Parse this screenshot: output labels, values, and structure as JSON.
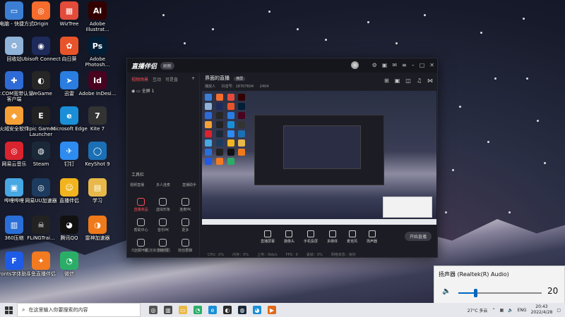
{
  "desktop": {
    "icons": [
      {
        "label": "此电脑 - 快捷方式",
        "color": "#3b7ed4",
        "glyph": "▭"
      },
      {
        "label": "Origin",
        "color": "#f56c2d",
        "glyph": "◎"
      },
      {
        "label": "WizTree",
        "color": "#e34b3a",
        "glyph": "▦"
      },
      {
        "label": "Adobe Illustrat...",
        "color": "#330000",
        "glyph": "Ai"
      },
      {
        "label": "回收站",
        "color": "#8fb3d9",
        "glyph": "♻"
      },
      {
        "label": "Ubisoft Connect",
        "color": "#1e2a5a",
        "glyph": "◉"
      },
      {
        "label": "向日葵",
        "color": "#e8542a",
        "glyph": "✿"
      },
      {
        "label": "Adobe Photosh...",
        "color": "#001e36",
        "glyph": "Ps"
      },
      {
        "label": "Dr.COM宽带认证客户端",
        "color": "#2f6bd6",
        "glyph": "✚"
      },
      {
        "label": "WeGame",
        "color": "#262626",
        "glyph": "◐"
      },
      {
        "label": "迅雷",
        "color": "#2a7de1",
        "glyph": "➤"
      },
      {
        "label": "Adobe InDesi...",
        "color": "#49021f",
        "glyph": "Id"
      },
      {
        "label": "火绒安全软件",
        "color": "#f7a035",
        "glyph": "◆"
      },
      {
        "label": "Epic Games Launcher",
        "color": "#222",
        "glyph": "E"
      },
      {
        "label": "Microsoft Edge",
        "color": "#1a8fd8",
        "glyph": "e"
      },
      {
        "label": "Kite 7",
        "color": "#333",
        "glyph": "7"
      },
      {
        "label": "网易云音乐",
        "color": "#d9232e",
        "glyph": "◎"
      },
      {
        "label": "Steam",
        "color": "#1b2838",
        "glyph": "◍"
      },
      {
        "label": "钉钉",
        "color": "#2e8bf0",
        "glyph": "✈"
      },
      {
        "label": "KeyShot 9",
        "color": "#1a6fb5",
        "glyph": "◯"
      },
      {
        "label": "哔哩哔哩",
        "color": "#48a8e4",
        "glyph": "▣"
      },
      {
        "label": "网易UU加速器",
        "color": "#1d3b5e",
        "glyph": "◎"
      },
      {
        "label": "直播伴侣",
        "color": "#f2b41e",
        "glyph": "☺"
      },
      {
        "label": "学习",
        "color": "#e8b94a",
        "glyph": "▤"
      },
      {
        "label": "360压缩",
        "color": "#2a6ed8",
        "glyph": "▥"
      },
      {
        "label": "FLiNGTrai...",
        "color": "#222",
        "glyph": "☠"
      },
      {
        "label": "腾讯QQ",
        "color": "#111",
        "glyph": "◕"
      },
      {
        "label": "雷神加速器",
        "color": "#f07a1a",
        "glyph": "◑"
      },
      {
        "label": "iFonts字体助手",
        "color": "#1e5be6",
        "glyph": "F"
      },
      {
        "label": "斗鱼直播伴侣",
        "color": "#f27a21",
        "glyph": "✦"
      },
      {
        "label": "微信",
        "color": "#2aae67",
        "glyph": "◔"
      }
    ]
  },
  "app": {
    "title": "直播伴侣",
    "badge": "刷新",
    "left_tabs": [
      "视频场景",
      "互动",
      "可是直"
    ],
    "scene_label": "全屏 1",
    "tools_title": "工具栏",
    "tools_row1": [
      "视频直播",
      "多人连麦",
      "直播助手"
    ],
    "tools": [
      {
        "label": "直播商品",
        "highlight": true
      },
      {
        "label": "虚拟形象",
        "highlight": false
      },
      {
        "label": "连麦PK",
        "highlight": false
      },
      {
        "label": "帮助中心",
        "highlight": false
      },
      {
        "label": "音乐PK",
        "highlight": false
      },
      {
        "label": "更多",
        "highlight": false
      },
      {
        "label": "上头一起",
        "highlight": false
      },
      {
        "label": "粉丝团",
        "highlight": false
      },
      {
        "label": "粉丝群聊",
        "highlight": false
      }
    ],
    "footer_note": "你可把手机连接直播伴侣",
    "stage_title": "界面的直播",
    "stage_tag": "横屏",
    "stage_meta": [
      "播放人",
      "抖音号：18707604",
      "2404"
    ],
    "bottom_tools": [
      "直播屏幕",
      "摄像头",
      "手机投屏",
      "多媒体",
      "麦克风",
      "扬声器"
    ],
    "go_live": "开始直播",
    "stats": [
      "CPU：0%",
      "内存：0%",
      "上传：0kb/s",
      "FPS：0",
      "丢帧：0%",
      "网络状态：良好"
    ]
  },
  "volume": {
    "device": "扬声器 (Realtek(R) Audio)",
    "level": 20,
    "level_text": "20"
  },
  "taskbar": {
    "search_placeholder": "在这里输入你要搜索的内容",
    "apps": [
      {
        "name": "task-view-icon",
        "color": "#555",
        "glyph": "◎"
      },
      {
        "name": "store-icon",
        "color": "#4a4a4a",
        "glyph": "▥"
      },
      {
        "name": "explorer-icon",
        "color": "#e8b94a",
        "glyph": "▭"
      },
      {
        "name": "wechat-icon",
        "color": "#2aae67",
        "glyph": "◔"
      },
      {
        "name": "edge-icon",
        "color": "#1a8fd8",
        "glyph": "e"
      },
      {
        "name": "wegame-icon",
        "color": "#2a2a2a",
        "glyph": "◐"
      },
      {
        "name": "steam-icon",
        "color": "#1b2838",
        "glyph": "◍"
      },
      {
        "name": "qq-icon",
        "color": "#1a8fd8",
        "glyph": "◕"
      },
      {
        "name": "zhibo-icon",
        "color": "#e06a1a",
        "glyph": "▶"
      }
    ],
    "weather": "27°C 多云",
    "lang": "ENG",
    "time": "20:43",
    "date": "2022/4/28"
  }
}
